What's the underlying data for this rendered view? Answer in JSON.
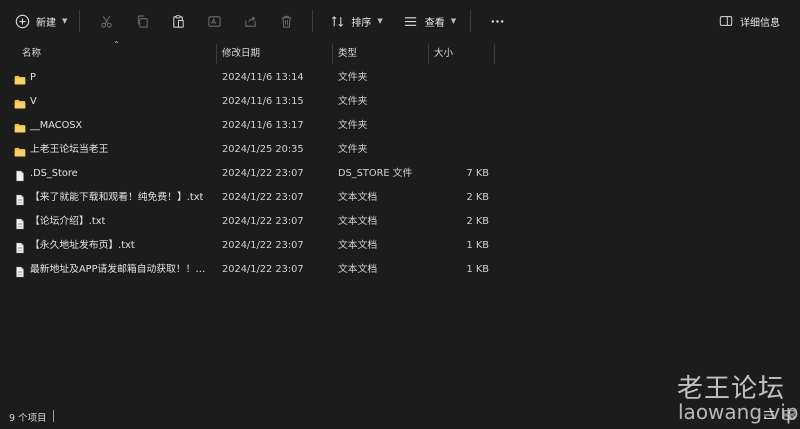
{
  "toolbar": {
    "new_label": "新建",
    "sort_label": "排序",
    "view_label": "查看",
    "details_label": "详细信息"
  },
  "columns": {
    "name": "名称",
    "date": "修改日期",
    "type": "类型",
    "size": "大小"
  },
  "files": [
    {
      "name": "P",
      "date": "2024/11/6 13:14",
      "type": "文件夹",
      "size": "",
      "icon": "folder-icon"
    },
    {
      "name": "V",
      "date": "2024/11/6 13:15",
      "type": "文件夹",
      "size": "",
      "icon": "folder-icon"
    },
    {
      "name": "__MACOSX",
      "date": "2024/11/6 13:17",
      "type": "文件夹",
      "size": "",
      "icon": "folder-icon"
    },
    {
      "name": "上老王论坛当老王",
      "date": "2024/1/25 20:35",
      "type": "文件夹",
      "size": "",
      "icon": "folder-icon"
    },
    {
      "name": ".DS_Store",
      "date": "2024/1/22 23:07",
      "type": "DS_STORE 文件",
      "size": "7 KB",
      "icon": "file-icon"
    },
    {
      "name": "【来了就能下载和观看！纯免费！】.txt",
      "date": "2024/1/22 23:07",
      "type": "文本文档",
      "size": "2 KB",
      "icon": "text-file-icon"
    },
    {
      "name": "【论坛介绍】.txt",
      "date": "2024/1/22 23:07",
      "type": "文本文档",
      "size": "2 KB",
      "icon": "text-file-icon"
    },
    {
      "name": "【永久地址发布页】.txt",
      "date": "2024/1/22 23:07",
      "type": "文本文档",
      "size": "1 KB",
      "icon": "text-file-icon"
    },
    {
      "name": "最新地址及APP请发邮箱自动获取！！！...",
      "date": "2024/1/22 23:07",
      "type": "文本文档",
      "size": "1 KB",
      "icon": "text-file-icon"
    }
  ],
  "status": {
    "item_count": "9 个项目"
  },
  "watermark": {
    "line1": "老王论坛",
    "line2": "laowang.vip"
  },
  "colors": {
    "background": "#1c1c1c",
    "folder": "#f3c24c",
    "text": "#e2e2e2"
  }
}
